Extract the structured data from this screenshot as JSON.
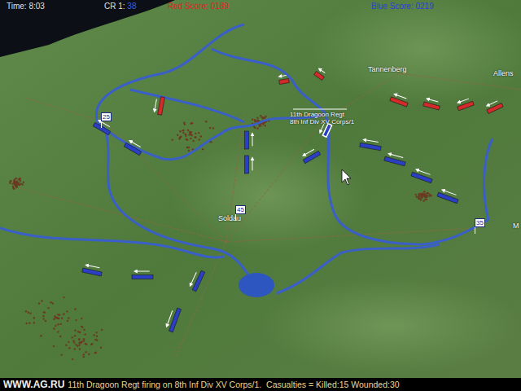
{
  "hud": {
    "time": "Time: 8:03",
    "cr_label": "CR 1:",
    "cr_value": "38",
    "red_score": "Red Score: 0189",
    "blue_score": "Blue Score: 0219"
  },
  "map": {
    "places": [
      {
        "name": "Tannenberg"
      },
      {
        "name": "Allens"
      },
      {
        "name": "Soldau"
      },
      {
        "name": "M"
      }
    ],
    "markers": [
      {
        "label": "25"
      },
      {
        "label": "45"
      },
      {
        "label": "35"
      }
    ],
    "selected_unit": {
      "name": "11th Dragoon Regt",
      "target": "8th Inf Div XV Corps/1"
    },
    "units": [
      {
        "color": "#d42a2a",
        "selected": false
      },
      {
        "color": "#d42a2a",
        "selected": false
      },
      {
        "color": "#d42a2a",
        "selected": false
      },
      {
        "color": "#d42a2a",
        "selected": false
      },
      {
        "color": "#d42a2a",
        "selected": false
      },
      {
        "color": "#d42a2a",
        "selected": false
      },
      {
        "color": "#d42a2a",
        "selected": false
      },
      {
        "color": "#2b3fc4",
        "selected": false
      },
      {
        "color": "#2b3fc4",
        "selected": false
      },
      {
        "color": "#2b3fc4",
        "selected": false
      },
      {
        "color": "#2b3fc4",
        "selected": false
      },
      {
        "color": "#2b3fc4",
        "selected": false
      },
      {
        "color": "#2b3fc4",
        "selected": true
      },
      {
        "color": "#2b3fc4",
        "selected": false
      },
      {
        "color": "#2b3fc4",
        "selected": false
      },
      {
        "color": "#2b3fc4",
        "selected": false
      },
      {
        "color": "#2b3fc4",
        "selected": false
      },
      {
        "color": "#2b3fc4",
        "selected": false
      },
      {
        "color": "#2b3fc4",
        "selected": false
      },
      {
        "color": "#2b3fc4",
        "selected": false
      },
      {
        "color": "#2b3fc4",
        "selected": false
      }
    ]
  },
  "status_bar": {
    "message": "11th Dragoon Regt firing on 8th Inf Div XV Corps/1.  Casualties = Killed:15 Wounded:30",
    "watermark": "WWW.AG.RU"
  }
}
